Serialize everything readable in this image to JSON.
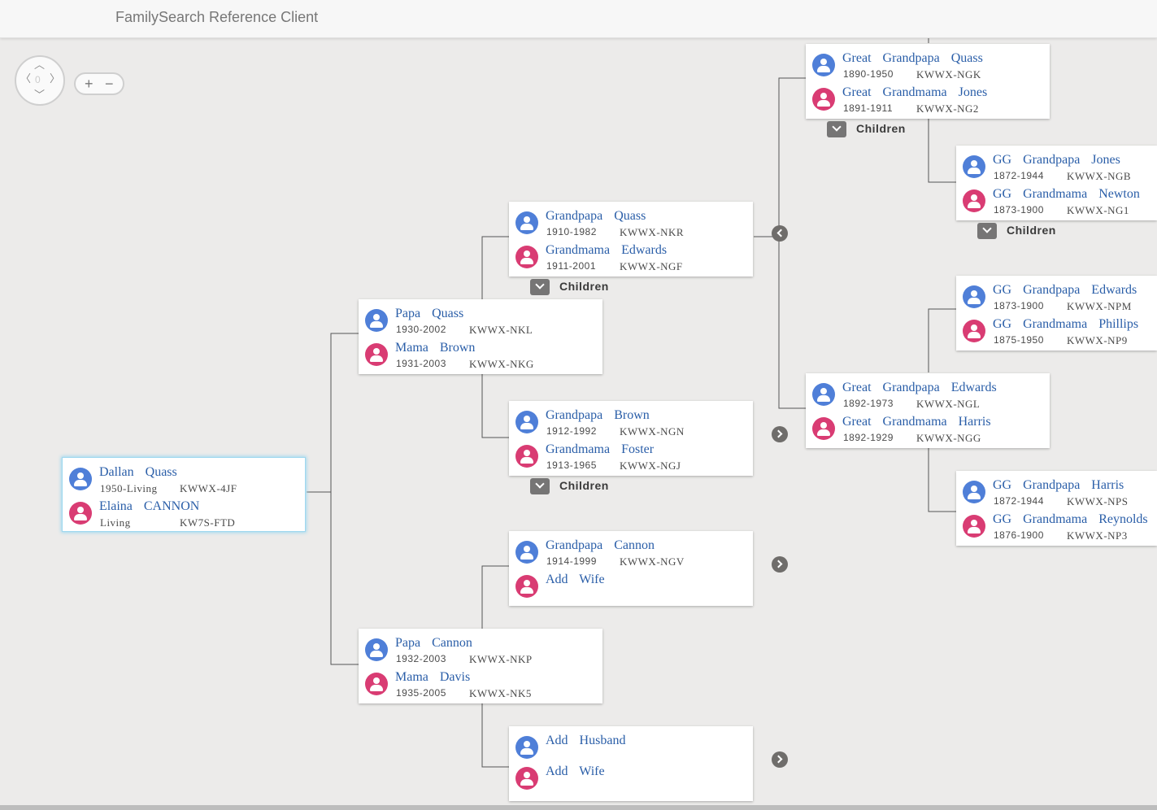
{
  "app": {
    "title": "FamilySearch Reference Client"
  },
  "controls": {
    "pan_center": "0",
    "zoom_in": "+",
    "zoom_out": "−"
  },
  "couples": {
    "root": {
      "husband": {
        "name": "Dallan  Quass",
        "dates": "1950-Living",
        "id": "KWWX-4JF"
      },
      "wife": {
        "name": "Elaina  CANNON",
        "dates": "Living",
        "id": "KW7S-FTD"
      }
    },
    "papa_quass": {
      "husband": {
        "name": "Papa  Quass",
        "dates": "1930-2002",
        "id": "KWWX-NKL"
      },
      "wife": {
        "name": "Mama  Brown",
        "dates": "1931-2003",
        "id": "KWWX-NKG"
      }
    },
    "papa_cannon": {
      "husband": {
        "name": "Papa  Cannon",
        "dates": "1932-2003",
        "id": "KWWX-NKP"
      },
      "wife": {
        "name": "Mama  Davis",
        "dates": "1935-2005",
        "id": "KWWX-NK5"
      }
    },
    "grandpapa_quass": {
      "husband": {
        "name": "Grandpapa  Quass",
        "dates": "1910-1982",
        "id": "KWWX-NKR"
      },
      "wife": {
        "name": "Grandmama  Edwards",
        "dates": "1911-2001",
        "id": "KWWX-NGF"
      }
    },
    "grandpapa_brown": {
      "husband": {
        "name": "Grandpapa  Brown",
        "dates": "1912-1992",
        "id": "KWWX-NGN"
      },
      "wife": {
        "name": "Grandmama  Foster",
        "dates": "1913-1965",
        "id": "KWWX-NGJ"
      }
    },
    "grandpapa_cannon": {
      "husband": {
        "name": "Grandpapa  Cannon",
        "dates": "1914-1999",
        "id": "KWWX-NGV"
      },
      "wife": {
        "name": "Add  Wife"
      }
    },
    "unknown_davis": {
      "husband": {
        "name": "Add  Husband"
      },
      "wife": {
        "name": "Add  Wife"
      }
    },
    "great_quass": {
      "husband": {
        "name": "Great  Grandpapa  Quass",
        "dates": "1890-1950",
        "id": "KWWX-NGK"
      },
      "wife": {
        "name": "Great  Grandmama  Jones",
        "dates": "1891-1911",
        "id": "KWWX-NG2"
      }
    },
    "great_edwards": {
      "husband": {
        "name": "Great  Grandpapa  Edwards",
        "dates": "1892-1973",
        "id": "KWWX-NGL"
      },
      "wife": {
        "name": "Great  Grandmama  Harris",
        "dates": "1892-1929",
        "id": "KWWX-NGG"
      }
    },
    "gg_jones": {
      "husband": {
        "name": "GG  Grandpapa  Jones",
        "dates": "1872-1944",
        "id": "KWWX-NGB"
      },
      "wife": {
        "name": "GG  Grandmama  Newton",
        "dates": "1873-1900",
        "id": "KWWX-NG1"
      }
    },
    "gg_edwards": {
      "husband": {
        "name": "GG  Grandpapa  Edwards",
        "dates": "1873-1900",
        "id": "KWWX-NPM"
      },
      "wife": {
        "name": "GG  Grandmama  Phillips",
        "dates": "1875-1950",
        "id": "KWWX-NP9"
      }
    },
    "gg_harris": {
      "husband": {
        "name": "GG  Grandpapa  Harris",
        "dates": "1872-1944",
        "id": "KWWX-NPS"
      },
      "wife": {
        "name": "GG  Grandmama  Reynolds",
        "dates": "1876-1900",
        "id": "KWWX-NP3"
      }
    }
  },
  "labels": {
    "children": "Children"
  }
}
